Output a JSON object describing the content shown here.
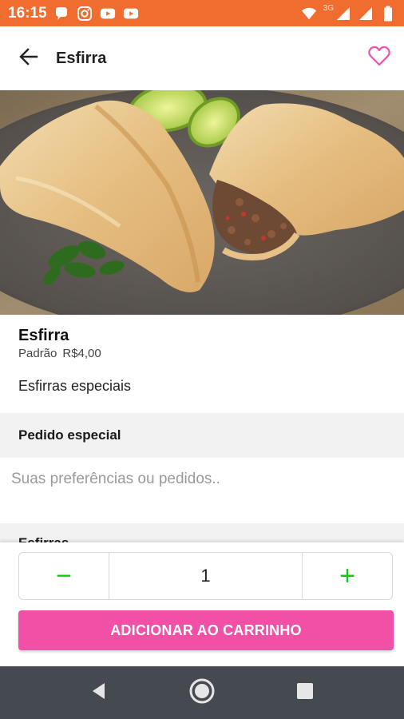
{
  "status_bar": {
    "time": "16:15",
    "left_icons": [
      "chat-bubble-icon",
      "instagram-icon",
      "youtube-icon",
      "youtube-icon"
    ],
    "network": "3G",
    "right_icons": [
      "wifi-icon",
      "signal-icon",
      "signal-icon",
      "battery-icon"
    ],
    "color": "#f06d2f"
  },
  "app_bar": {
    "title": "Esfirra",
    "back_icon": "arrow-back-icon",
    "favorite_icon": "heart-outline-icon",
    "accent": "#f250a6"
  },
  "product": {
    "name": "Esfirra",
    "size_label": "Padrão",
    "price": "R$4,00",
    "description": "Esfirras especiais"
  },
  "special_order": {
    "title": "Pedido especial",
    "placeholder": "Suas preferências ou pedidos.."
  },
  "next_section": {
    "title": "Esfirras"
  },
  "quantity": {
    "minus": "−",
    "value": "1",
    "plus": "+",
    "color": "#1ec31e"
  },
  "add_to_cart": {
    "label": "ADICIONAR AO CARRINHO",
    "color": "#f250a6"
  },
  "nav_bar": {
    "icons": [
      "nav-back-icon",
      "nav-home-icon",
      "nav-recents-icon"
    ]
  }
}
